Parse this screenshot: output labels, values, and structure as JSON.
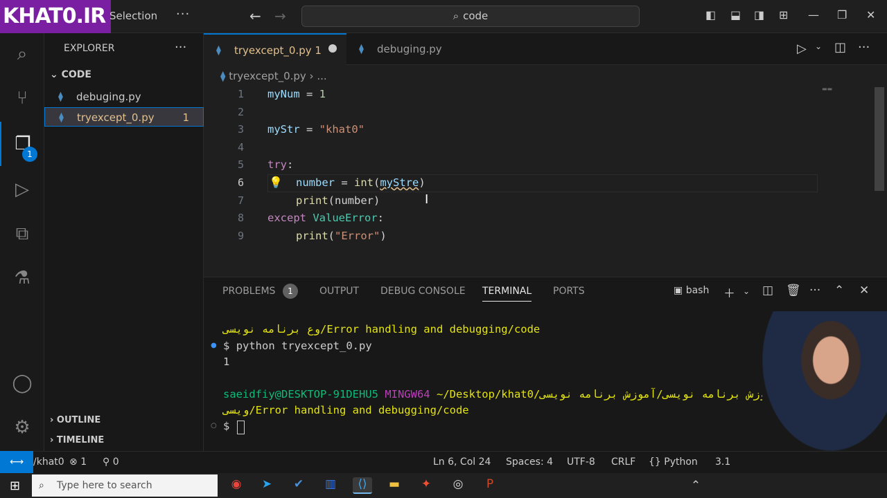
{
  "titlebar": {
    "logo": "KHAT0.IR",
    "menu_selection": "Selection",
    "menu_more": "···",
    "back": "←",
    "forward": "→",
    "command_center": "code"
  },
  "activity": {
    "explorer_badge": "1"
  },
  "sidebar": {
    "title": "EXPLORER",
    "more": "···",
    "folder": "CODE",
    "files": [
      {
        "name": "debuging.py",
        "problems": ""
      },
      {
        "name": "tryexcept_0.py",
        "problems": "1"
      }
    ],
    "outline": "OUTLINE",
    "timeline": "TIMELINE"
  },
  "tabs": [
    {
      "label": "tryexcept_0.py",
      "problems": "1"
    },
    {
      "label": "debuging.py"
    }
  ],
  "breadcrumb": {
    "file": "tryexcept_0.py",
    "more": "..."
  },
  "editor": {
    "line_numbers": [
      "1",
      "2",
      "3",
      "4",
      "5",
      "6",
      "7",
      "8",
      "9"
    ],
    "lines": {
      "l1_var": "myNum",
      "l1_eq": " = ",
      "l1_val": "1",
      "l3_var": "myStr",
      "l3_eq": " = ",
      "l3_val": "\"khat0\"",
      "l5_kw": "try",
      "l5_colon": ":",
      "l6_var": "number",
      "l6_eq": " = ",
      "l6_fn": "int",
      "l6_open": "(",
      "l6_arg": "myStre",
      "l6_close": ")",
      "l7_fn": "print",
      "l7_rest": "(number)",
      "l8_kw": "except",
      "l8_cls": "ValueError",
      "l8_colon": ":",
      "l9_fn": "print",
      "l9_open": "(",
      "l9_str": "\"Error\"",
      "l9_close": ")"
    }
  },
  "panel": {
    "tabs": [
      "PROBLEMS",
      "OUTPUT",
      "DEBUG CONSOLE",
      "TERMINAL",
      "PORTS"
    ],
    "problems_count": "1",
    "shell": "bash",
    "terminal": {
      "line1": "وع برنامه نویسی/Error handling and debugging/code",
      "prompt1_symbol": "$",
      "prompt1_cmd": "python tryexcept_0.py",
      "output1": "1",
      "user_host": "saeidfiy@DESKTOP-91DEHU5",
      "system": "MINGW64",
      "path": "~/Desktop/khat0/دوره های آموزشی/آموزش برنامه نویسی/آموزش برنامه نویسی",
      "path2": "ویسی/Error handling and debugging/code",
      "prompt2_symbol": "$"
    }
  },
  "status": {
    "remote": "/khat0",
    "errors": "1",
    "ports": "0",
    "position": "Ln 6, Col 24",
    "spaces": "Spaces: 4",
    "encoding": "UTF-8",
    "eol": "CRLF",
    "language": "Python",
    "version": "3.1"
  },
  "taskbar": {
    "search_placeholder": "Type here to search"
  },
  "colors": {
    "accent": "#0078d4",
    "modified": "#e2c08d",
    "logo_bg": "#7a1fa2"
  }
}
